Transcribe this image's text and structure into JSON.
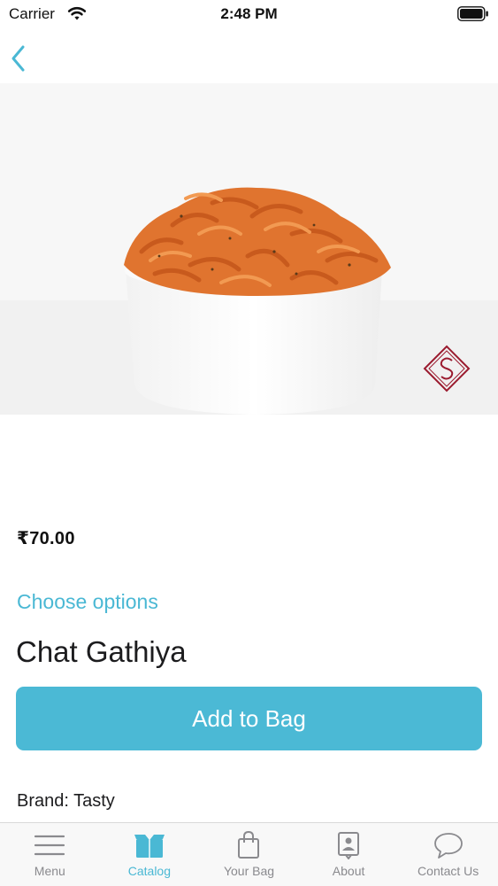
{
  "status_bar": {
    "carrier": "Carrier",
    "time": "2:48 PM"
  },
  "nav": {
    "back_icon": "chevron-left-icon"
  },
  "product": {
    "price": "₹70.00",
    "choose_options": "Choose options",
    "name": "Chat Gathiya",
    "add_to_bag": "Add to Bag",
    "brand": "Brand: Tasty"
  },
  "colors": {
    "accent": "#4bb9d5",
    "logo": "#9b1b2f"
  },
  "tabbar": {
    "items": [
      {
        "label": "Menu",
        "icon": "menu-icon",
        "active": false
      },
      {
        "label": "Catalog",
        "icon": "box-icon",
        "active": true
      },
      {
        "label": "Your Bag",
        "icon": "shopping-bag-icon",
        "active": false
      },
      {
        "label": "About",
        "icon": "contact-card-icon",
        "active": false
      },
      {
        "label": "Contact Us",
        "icon": "chat-bubble-icon",
        "active": false
      }
    ]
  }
}
